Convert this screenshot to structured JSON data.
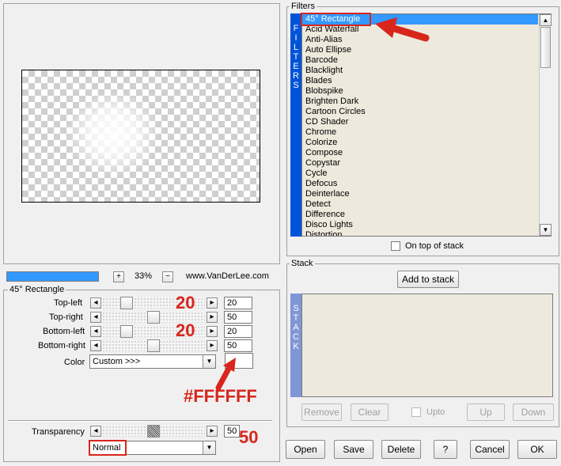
{
  "preview": {
    "zoom_in_label": "+",
    "zoom_value": "33%",
    "zoom_out_label": "−",
    "site": "www.VanDerLee.com"
  },
  "params": {
    "group_title": "45° Rectangle",
    "rows": [
      {
        "label": "Top-left",
        "value": "20"
      },
      {
        "label": "Top-right",
        "value": "50"
      },
      {
        "label": "Bottom-left",
        "value": "20"
      },
      {
        "label": "Bottom-right",
        "value": "50"
      }
    ],
    "color_label": "Color",
    "color_value": "Custom >>>",
    "transparency_label": "Transparency",
    "transparency_value": "50",
    "blend_mode": "Normal",
    "swatch_color": "#FFFFFF"
  },
  "annotations": {
    "top_left_hint": "20",
    "bottom_left_hint": "20",
    "color_hint": "#FFFFFF",
    "transparency_hint": "50",
    "accent_color": "#d8261c"
  },
  "filters": {
    "group_title": "Filters",
    "strip_letters": [
      "F",
      "I",
      "L",
      "T",
      "E",
      "R",
      "S"
    ],
    "items": [
      "45° Rectangle",
      "Acid Waterfall",
      "Anti-Alias",
      "Auto Ellipse",
      "Barcode",
      "Blacklight",
      "Blades",
      "Blobspike",
      "Brighten Dark",
      "Cartoon Circles",
      "CD Shader",
      "Chrome",
      "Colorize",
      "Compose",
      "Copystar",
      "Cycle",
      "Defocus",
      "Deinterlace",
      "Detect",
      "Difference",
      "Disco Lights",
      "Distortion"
    ],
    "selected_index": 0,
    "on_top_label": "On top of stack"
  },
  "stack": {
    "group_title": "Stack",
    "add_label": "Add to stack",
    "strip_letters": [
      "S",
      "T",
      "A",
      "C",
      "K"
    ],
    "remove_label": "Remove",
    "clear_label": "Clear",
    "upto_label": "Upto",
    "up_label": "Up",
    "down_label": "Down"
  },
  "footer": {
    "open": "Open",
    "save": "Save",
    "delete": "Delete",
    "help": "?",
    "cancel": "Cancel",
    "ok": "OK"
  }
}
